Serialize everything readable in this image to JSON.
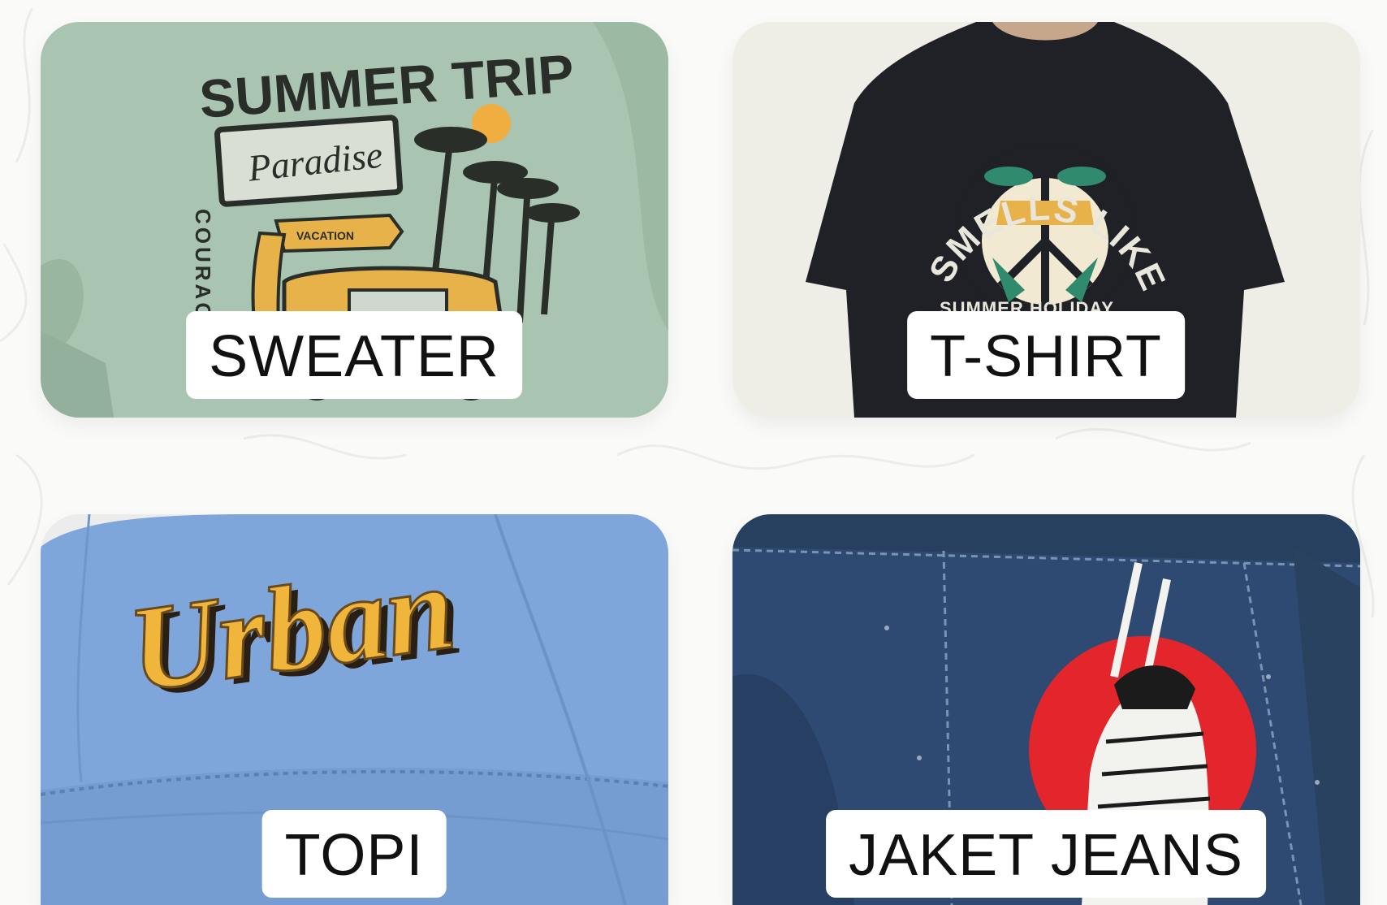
{
  "categories": [
    {
      "label": "SWEATER",
      "color": "#a8c3ae"
    },
    {
      "label": "T-SHIRT",
      "color": "#1d1f24"
    },
    {
      "label": "TOPI",
      "color": "#7fa7d9"
    },
    {
      "label": "JAKET JEANS",
      "color": "#2d4a72"
    }
  ],
  "artwork": {
    "sweater": {
      "headline": "SUMMER TRIP",
      "sign": "Paradise",
      "arrow": "VACATION",
      "side": "COURAGE"
    },
    "tshirt": {
      "arc": "SMELLS LIKE SUMMER",
      "bottom": "SUMMER HOLIDAY"
    },
    "topi": {
      "logo": "Urban"
    }
  }
}
